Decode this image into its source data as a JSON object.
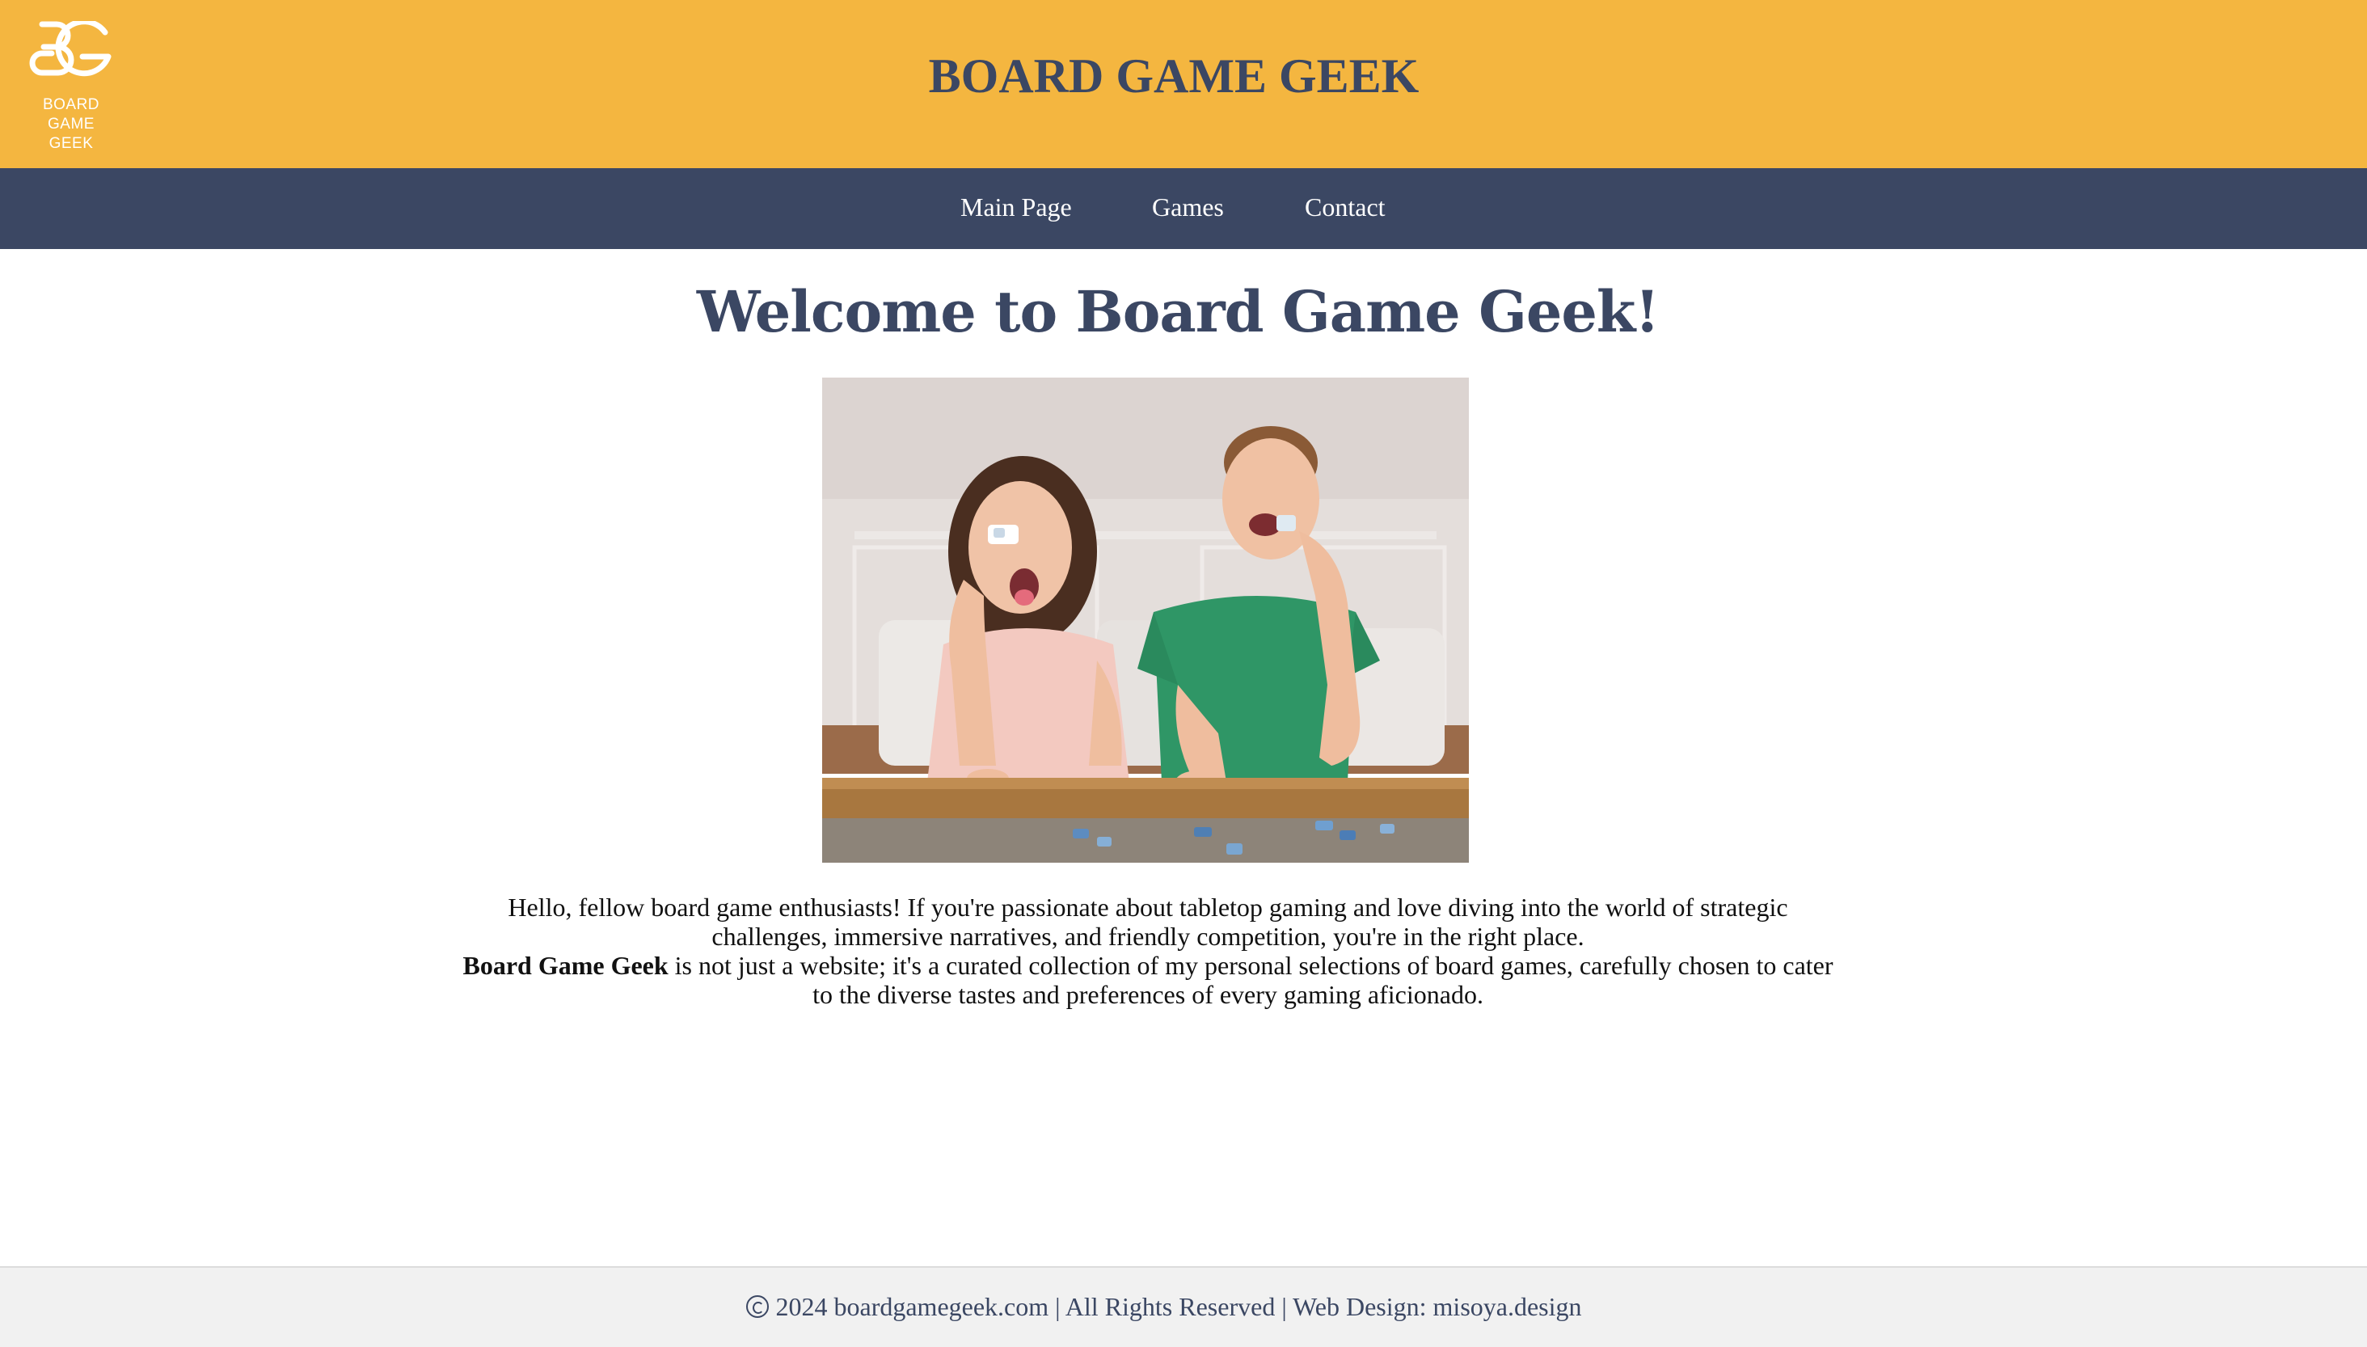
{
  "header": {
    "logo_line1": "BOARD",
    "logo_line2": "GAME GEEK",
    "title": "BOARD GAME GEEK"
  },
  "nav": {
    "items": [
      {
        "label": "Main Page"
      },
      {
        "label": "Games"
      },
      {
        "label": "Contact"
      }
    ]
  },
  "main": {
    "heading": "Welcome to Board Game Geek!",
    "intro_line1": "Hello, fellow board game enthusiasts! If you're passionate about tabletop gaming and love diving into the world of strategic challenges, immersive narratives, and friendly competition, you're in the right place.",
    "intro_brand": "Board Game Geek",
    "intro_line2": "is not just a website; it's a curated collection of my personal selections of board games, carefully chosen to cater to the diverse tastes and preferences of every gaming aficionado."
  },
  "footer": {
    "text": "2024 boardgamegeek.com | All Rights Reserved | Web Design: misoya.design"
  },
  "colors": {
    "header_bg": "#f4b640",
    "nav_bg": "#3b4763",
    "title": "#3b4763",
    "footer_bg": "#f1f1f1"
  }
}
